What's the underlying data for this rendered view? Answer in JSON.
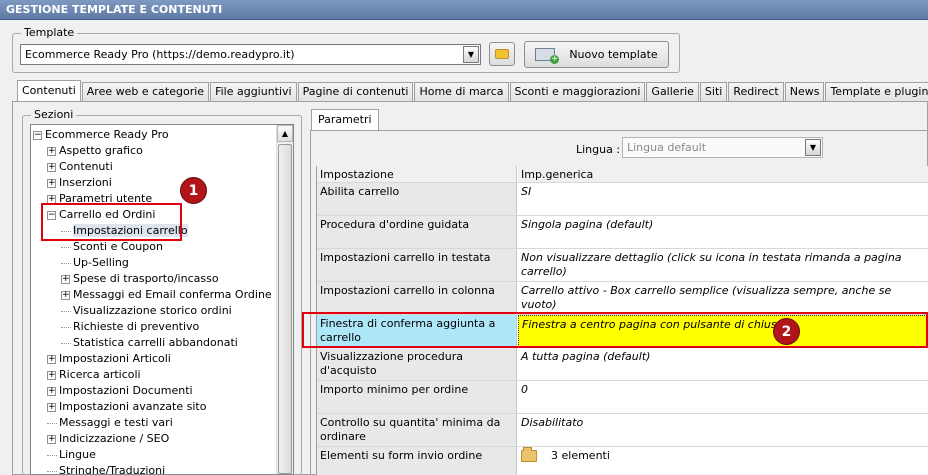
{
  "window": {
    "title": "GESTIONE TEMPLATE E CONTENUTI"
  },
  "template_group": {
    "legend": "Template",
    "selected": "Ecommerce Ready Pro (https://demo.readypro.it)",
    "new_button_label": "Nuovo template"
  },
  "main_tabs": [
    {
      "label": "Contenuti",
      "active": true
    },
    {
      "label": "Aree web e categorie"
    },
    {
      "label": "File aggiuntivi"
    },
    {
      "label": "Pagine di contenuti"
    },
    {
      "label": "Home di marca"
    },
    {
      "label": "Sconti e maggiorazioni"
    },
    {
      "label": "Gallerie"
    },
    {
      "label": "Siti"
    },
    {
      "label": "Redirect"
    },
    {
      "label": "News"
    },
    {
      "label": "Template e plugins"
    }
  ],
  "sections": {
    "legend": "Sezioni",
    "tree": [
      {
        "label": "Ecommerce Ready Pro",
        "level": 0,
        "expander": "−"
      },
      {
        "label": "Aspetto grafico",
        "level": 1,
        "expander": "+"
      },
      {
        "label": "Contenuti",
        "level": 1,
        "expander": "+"
      },
      {
        "label": "Inserzioni",
        "level": 1,
        "expander": "+"
      },
      {
        "label": "Parametri utente",
        "level": 1,
        "expander": "+"
      },
      {
        "label": "Carrello ed Ordini",
        "level": 1,
        "expander": "−"
      },
      {
        "label": "Impostazioni carrello",
        "level": 2,
        "selected": true
      },
      {
        "label": "Sconti e Coupon",
        "level": 2
      },
      {
        "label": "Up-Selling",
        "level": 2
      },
      {
        "label": "Spese di trasporto/incasso",
        "level": 2,
        "expander": "+"
      },
      {
        "label": "Messaggi ed Email conferma Ordine",
        "level": 2,
        "expander": "+"
      },
      {
        "label": "Visualizzazione storico ordini",
        "level": 2
      },
      {
        "label": "Richieste di preventivo",
        "level": 2
      },
      {
        "label": "Statistica carrelli abbandonati",
        "level": 2
      },
      {
        "label": "Impostazioni Articoli",
        "level": 1,
        "expander": "+"
      },
      {
        "label": "Ricerca articoli",
        "level": 1,
        "expander": "+"
      },
      {
        "label": "Impostazioni Documenti",
        "level": 1,
        "expander": "+"
      },
      {
        "label": "Impostazioni avanzate sito",
        "level": 1,
        "expander": "+"
      },
      {
        "label": "Messaggi e testi vari",
        "level": 1
      },
      {
        "label": "Indicizzazione / SEO",
        "level": 1,
        "expander": "+"
      },
      {
        "label": "Lingue",
        "level": 1
      },
      {
        "label": "Stringhe/Traduzioni",
        "level": 1
      }
    ]
  },
  "params": {
    "tab_label": "Parametri",
    "language_label": "Lingua :",
    "language_value": "Lingua default",
    "col_setting": "Impostazione",
    "col_value": "Imp.generica",
    "rows": [
      {
        "name": "Abilita carrello",
        "value": "SI"
      },
      {
        "name": "Procedura d'ordine guidata",
        "value": "Singola pagina (default)"
      },
      {
        "name": "Impostazioni carrello in testata",
        "value": "Non visualizzare dettaglio (click su icona in testata rimanda a pagina carrello)"
      },
      {
        "name": "Impostazioni carrello in colonna",
        "value": "Carrello attivo - Box carrello semplice (visualizza sempre, anche se vuoto)"
      },
      {
        "name": "Finestra di conferma aggiunta a carrello",
        "value": "Finestra a centro pagina con pulsante di chiusura",
        "highlight": true
      },
      {
        "name": "Visualizzazione procedura d'acquisto",
        "value": "A tutta pagina (default)"
      },
      {
        "name": "Importo minimo per ordine",
        "value": "0"
      },
      {
        "name": "Controllo su quantita' minima da ordinare",
        "value": "Disabilitato"
      },
      {
        "name": "Elementi su form invio ordine",
        "value": "3 elementi",
        "icon": "folder-icon"
      }
    ]
  },
  "annotations": {
    "badge_1": "1",
    "badge_2": "2",
    "highlight_color": "#e0000f"
  }
}
